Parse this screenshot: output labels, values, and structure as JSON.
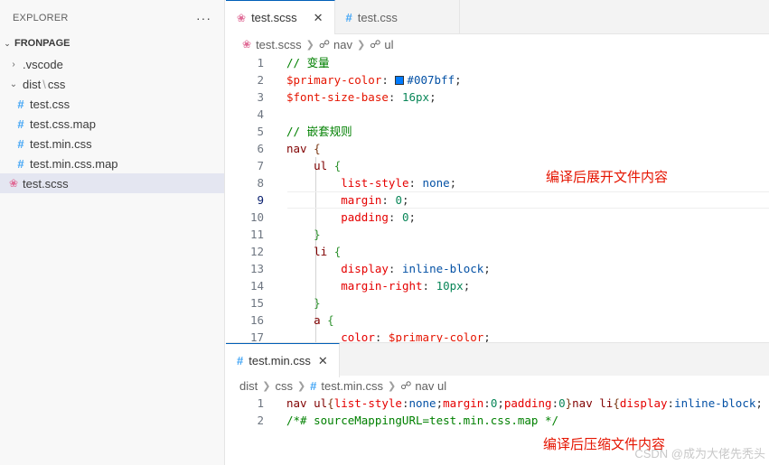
{
  "sidebar": {
    "title": "EXPLORER",
    "more": "···",
    "section": "FRONPAGE",
    "items": [
      {
        "label": ".vscode",
        "type": "folder"
      },
      {
        "label_a": "dist",
        "label_sep": "\\",
        "label_b": "css",
        "type": "folder-open"
      },
      {
        "label": "test.css",
        "type": "css"
      },
      {
        "label": "test.css.map",
        "type": "css"
      },
      {
        "label": "test.min.css",
        "type": "css"
      },
      {
        "label": "test.min.css.map",
        "type": "css"
      },
      {
        "label": "test.scss",
        "type": "scss",
        "selected": true
      }
    ]
  },
  "top_editor": {
    "tabs": [
      {
        "label": "test.scss",
        "active": true,
        "close": "✕"
      },
      {
        "label": "test.css",
        "active": false
      }
    ],
    "breadcrumb": [
      "test.scss",
      "nav",
      "ul"
    ],
    "lines": [
      {
        "n": "1",
        "tokens": [
          [
            "cm",
            "// 变量"
          ]
        ]
      },
      {
        "n": "2",
        "tokens": [
          [
            "var",
            "$primary-color"
          ],
          [
            "pun",
            ": "
          ],
          [
            "swatch",
            ""
          ],
          [
            "val",
            "#007bff"
          ],
          [
            "pun",
            ";"
          ]
        ]
      },
      {
        "n": "3",
        "tokens": [
          [
            "var",
            "$font-size-base"
          ],
          [
            "pun",
            ": "
          ],
          [
            "num",
            "16px"
          ],
          [
            "pun",
            ";"
          ]
        ]
      },
      {
        "n": "4",
        "tokens": []
      },
      {
        "n": "5",
        "tokens": [
          [
            "cm",
            "// 嵌套规则"
          ]
        ]
      },
      {
        "n": "6",
        "tokens": [
          [
            "sel",
            "nav"
          ],
          [
            "pun",
            " "
          ],
          [
            "brk2",
            "{"
          ]
        ]
      },
      {
        "n": "7",
        "tokens": [
          [
            "pun",
            "    "
          ],
          [
            "sel",
            "ul"
          ],
          [
            "pun",
            " "
          ],
          [
            "brk",
            "{"
          ]
        ]
      },
      {
        "n": "8",
        "tokens": [
          [
            "pun",
            "        "
          ],
          [
            "prop",
            "list-style"
          ],
          [
            "pun",
            ": "
          ],
          [
            "val",
            "none"
          ],
          [
            "pun",
            ";"
          ]
        ]
      },
      {
        "n": "9",
        "tokens": [
          [
            "pun",
            "        "
          ],
          [
            "prop",
            "margin"
          ],
          [
            "pun",
            ": "
          ],
          [
            "num",
            "0"
          ],
          [
            "pun",
            ";"
          ]
        ]
      },
      {
        "n": "10",
        "tokens": [
          [
            "pun",
            "        "
          ],
          [
            "prop",
            "padding"
          ],
          [
            "pun",
            ": "
          ],
          [
            "num",
            "0"
          ],
          [
            "pun",
            ";"
          ]
        ]
      },
      {
        "n": "11",
        "tokens": [
          [
            "pun",
            "    "
          ],
          [
            "brk",
            "}"
          ]
        ]
      },
      {
        "n": "12",
        "tokens": [
          [
            "pun",
            "    "
          ],
          [
            "sel",
            "li"
          ],
          [
            "pun",
            " "
          ],
          [
            "brk",
            "{"
          ]
        ]
      },
      {
        "n": "13",
        "tokens": [
          [
            "pun",
            "        "
          ],
          [
            "prop",
            "display"
          ],
          [
            "pun",
            ": "
          ],
          [
            "val",
            "inline-block"
          ],
          [
            "pun",
            ";"
          ]
        ]
      },
      {
        "n": "14",
        "tokens": [
          [
            "pun",
            "        "
          ],
          [
            "prop",
            "margin-right"
          ],
          [
            "pun",
            ": "
          ],
          [
            "num",
            "10px"
          ],
          [
            "pun",
            ";"
          ]
        ]
      },
      {
        "n": "15",
        "tokens": [
          [
            "pun",
            "    "
          ],
          [
            "brk",
            "}"
          ]
        ]
      },
      {
        "n": "16",
        "tokens": [
          [
            "pun",
            "    "
          ],
          [
            "sel",
            "a"
          ],
          [
            "pun",
            " "
          ],
          [
            "brk",
            "{"
          ]
        ]
      },
      {
        "n": "17",
        "tokens": [
          [
            "pun",
            "        "
          ],
          [
            "prop",
            "color"
          ],
          [
            "pun",
            ": "
          ],
          [
            "var",
            "$primary-color"
          ],
          [
            "pun",
            ";"
          ]
        ]
      }
    ],
    "annotation": "编译后展开文件内容"
  },
  "bottom_editor": {
    "tab": {
      "label": "test.min.css",
      "close": "✕"
    },
    "breadcrumb": [
      "dist",
      "css",
      "test.min.css",
      "nav ul"
    ],
    "lines": [
      {
        "n": "1",
        "tokens": [
          [
            "sel",
            "nav ul"
          ],
          [
            "brk2",
            "{"
          ],
          [
            "prop",
            "list-style"
          ],
          [
            "pun",
            ":"
          ],
          [
            "val",
            "none"
          ],
          [
            "pun",
            ";"
          ],
          [
            "prop",
            "margin"
          ],
          [
            "pun",
            ":"
          ],
          [
            "num",
            "0"
          ],
          [
            "pun",
            ";"
          ],
          [
            "prop",
            "padding"
          ],
          [
            "pun",
            ":"
          ],
          [
            "num",
            "0"
          ],
          [
            "brk2",
            "}"
          ],
          [
            "sel",
            "nav li"
          ],
          [
            "brk2",
            "{"
          ],
          [
            "prop",
            "display"
          ],
          [
            "pun",
            ":"
          ],
          [
            "val",
            "inline-block"
          ],
          [
            "pun",
            ";"
          ]
        ]
      },
      {
        "n": "2",
        "tokens": [
          [
            "cm",
            "/*# sourceMappingURL=test.min.css.map */"
          ]
        ]
      }
    ],
    "annotation": "编译后压缩文件内容"
  },
  "watermark": "CSDN @成为大佬先秃头",
  "colors": {
    "accent": "#005fb8",
    "annotation": "#e51400",
    "css_icon": "#42a5f5",
    "scss_icon": "#e06c97"
  }
}
